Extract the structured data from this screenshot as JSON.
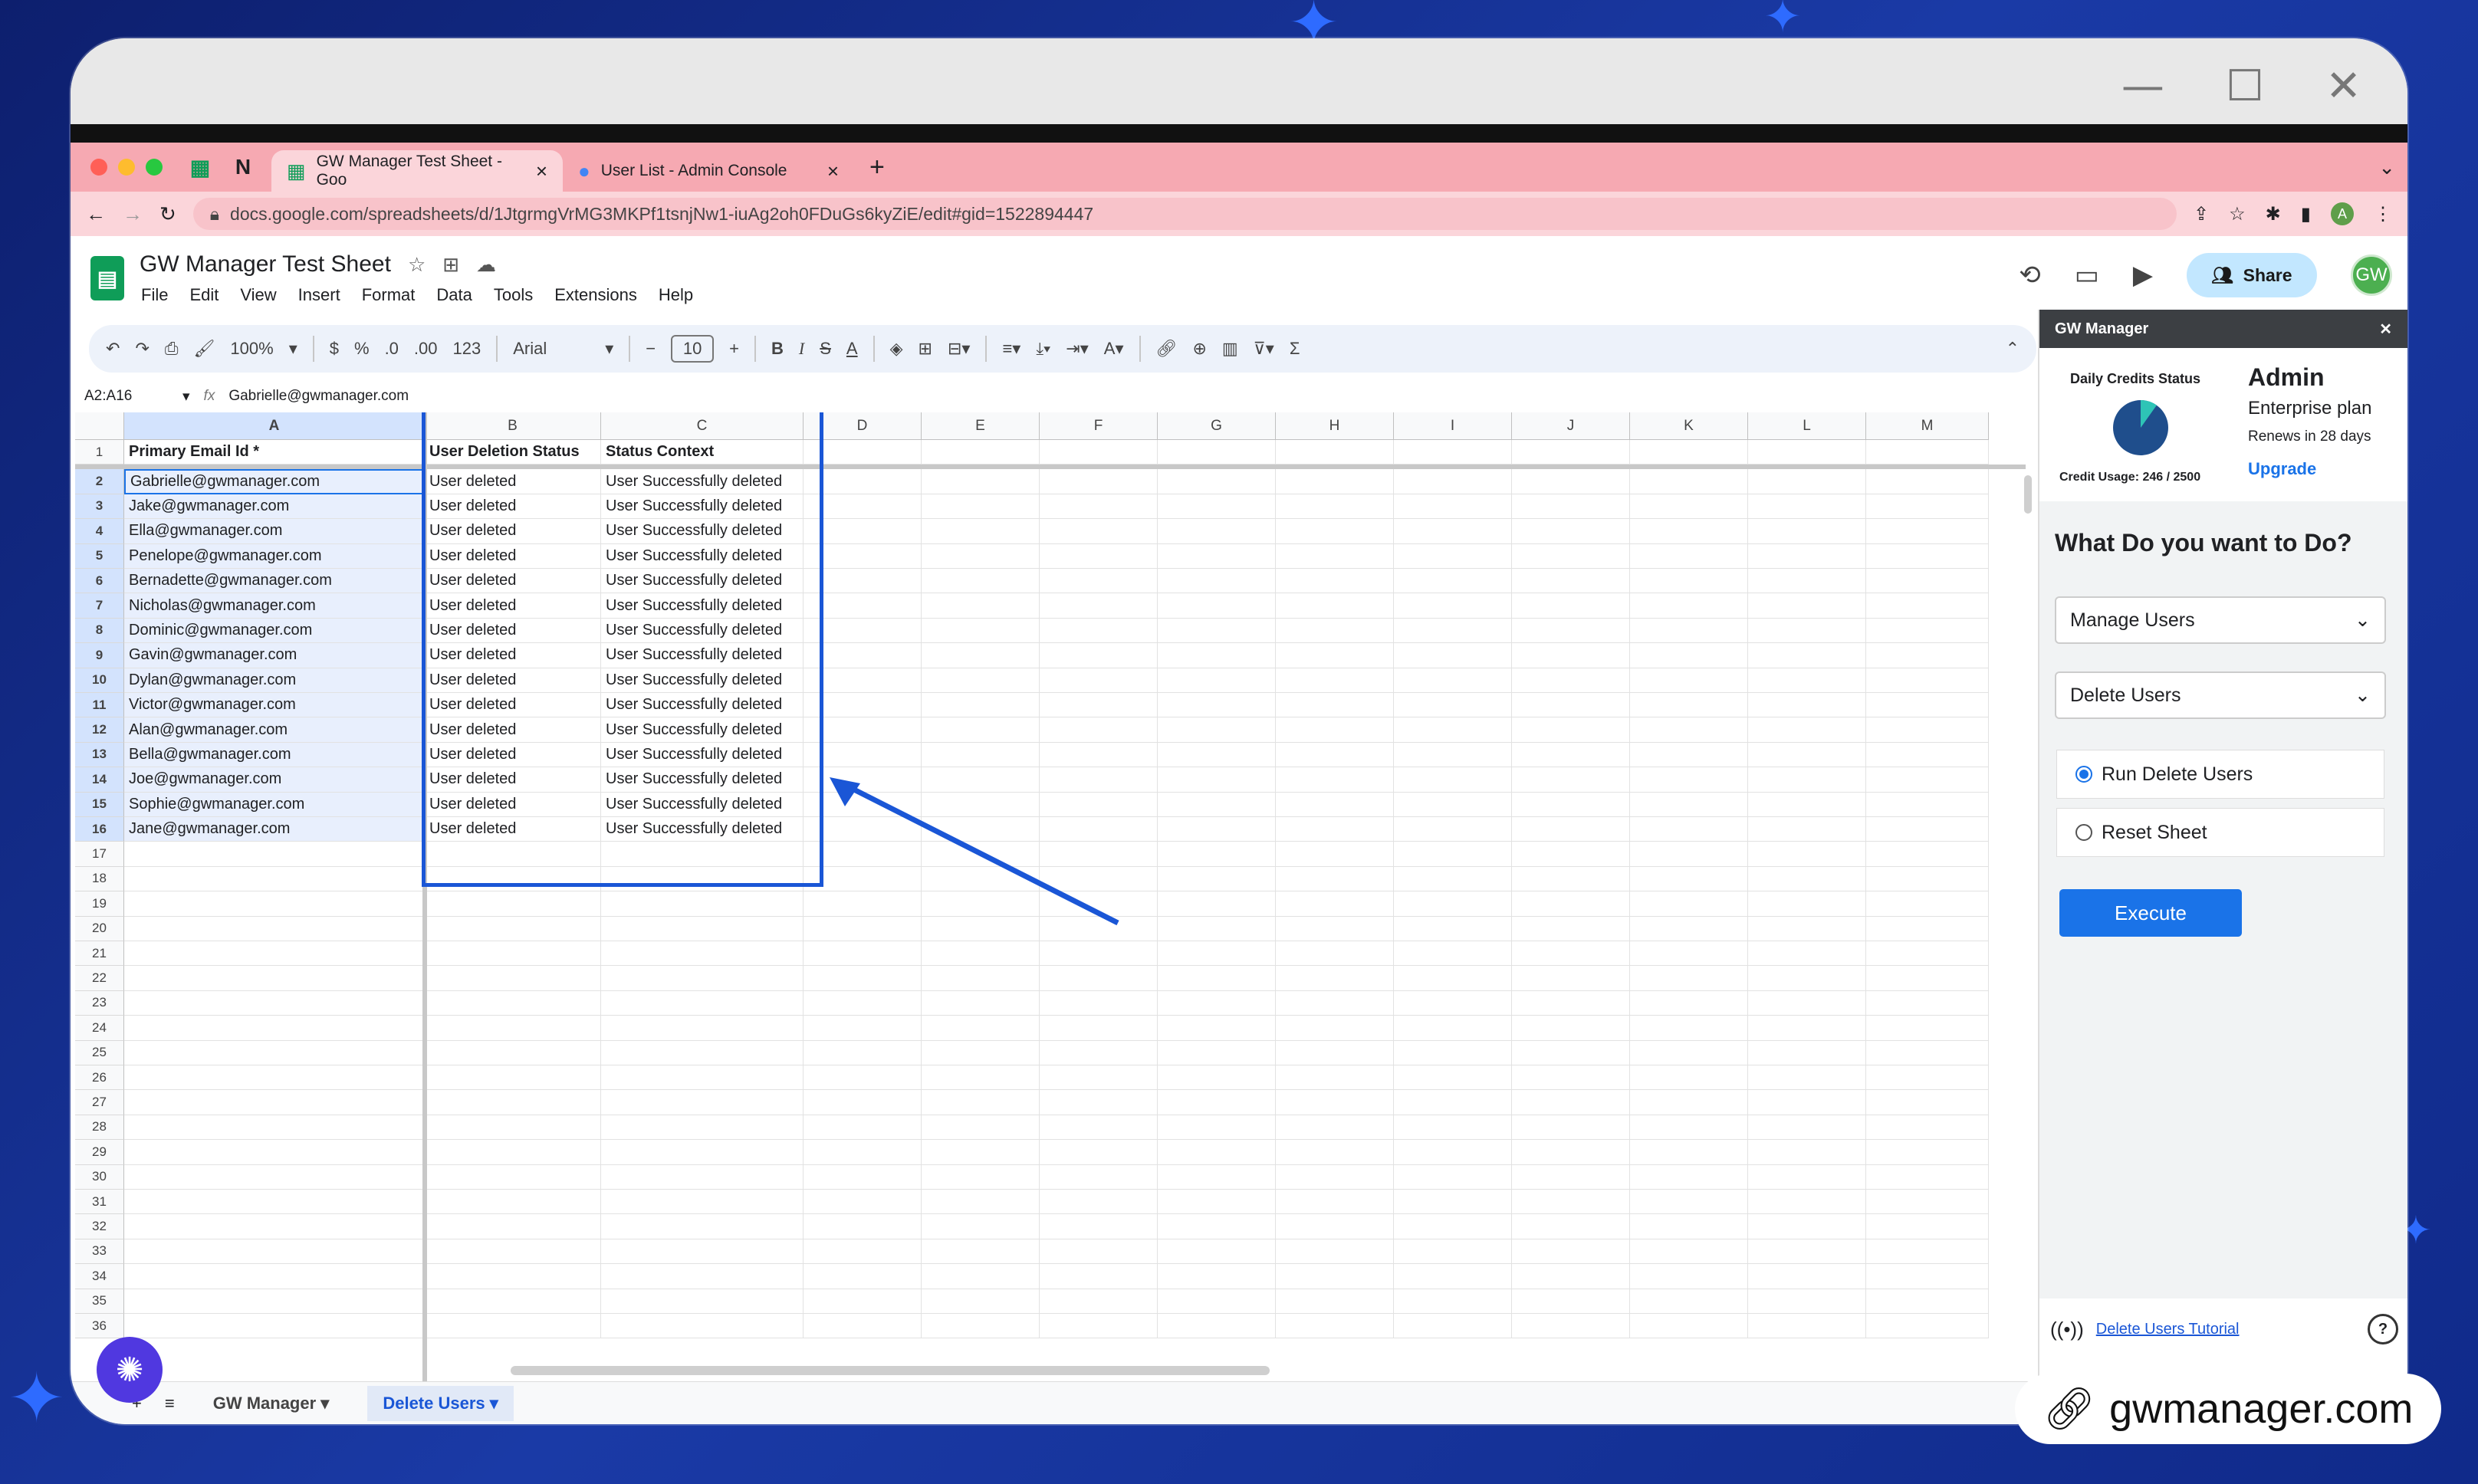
{
  "window": {
    "minimize": "—",
    "maximize": "☐",
    "close": "✕"
  },
  "browser": {
    "tabs": [
      {
        "label": "GW Manager Test Sheet - Goo",
        "active": true
      },
      {
        "label": "User List - Admin Console",
        "active": false
      }
    ],
    "url": "docs.google.com/spreadsheets/d/1JtgrmgVrMG3MKPf1tsnjNw1-iuAg2oh0FDuGs6kyZiE/edit#gid=1522894447",
    "avatar": "A"
  },
  "app": {
    "title": "GW Manager Test Sheet",
    "menu": [
      "File",
      "Edit",
      "View",
      "Insert",
      "Format",
      "Data",
      "Tools",
      "Extensions",
      "Help"
    ],
    "share_label": "Share",
    "user_avatar": "GW"
  },
  "toolbar": {
    "zoom": "100%",
    "currency": "$",
    "percent": "%",
    "dec_less": ".0",
    "dec_more": ".00",
    "number_format": "123",
    "font": "Arial",
    "font_size": "10"
  },
  "formula_bar": {
    "range": "A2:A16",
    "fx": "fx",
    "value": "Gabrielle@gwmanager.com"
  },
  "sheet": {
    "columns": [
      "A",
      "B",
      "C",
      "D",
      "E",
      "F",
      "G",
      "H",
      "I",
      "J",
      "K",
      "L",
      "M"
    ],
    "headers": [
      "Primary Email Id *",
      "User Deletion Status",
      "Status Context"
    ],
    "rows": [
      [
        "Gabrielle@gwmanager.com",
        "User deleted",
        "User Successfully deleted"
      ],
      [
        "Jake@gwmanager.com",
        "User deleted",
        "User Successfully deleted"
      ],
      [
        "Ella@gwmanager.com",
        "User deleted",
        "User Successfully deleted"
      ],
      [
        "Penelope@gwmanager.com",
        "User deleted",
        "User Successfully deleted"
      ],
      [
        "Bernadette@gwmanager.com",
        "User deleted",
        "User Successfully deleted"
      ],
      [
        "Nicholas@gwmanager.com",
        "User deleted",
        "User Successfully deleted"
      ],
      [
        "Dominic@gwmanager.com",
        "User deleted",
        "User Successfully deleted"
      ],
      [
        "Gavin@gwmanager.com",
        "User deleted",
        "User Successfully deleted"
      ],
      [
        "Dylan@gwmanager.com",
        "User deleted",
        "User Successfully deleted"
      ],
      [
        "Victor@gwmanager.com",
        "User deleted",
        "User Successfully deleted"
      ],
      [
        "Alan@gwmanager.com",
        "User deleted",
        "User Successfully deleted"
      ],
      [
        "Bella@gwmanager.com",
        "User deleted",
        "User Successfully deleted"
      ],
      [
        "Joe@gwmanager.com",
        "User deleted",
        "User Successfully deleted"
      ],
      [
        "Sophie@gwmanager.com",
        "User deleted",
        "User Successfully deleted"
      ],
      [
        "Jane@gwmanager.com",
        "User deleted",
        "User Successfully deleted"
      ]
    ],
    "row_count": 36,
    "tabs": [
      {
        "label": "GW Manager",
        "active": false
      },
      {
        "label": "Delete Users",
        "active": true
      }
    ],
    "highlight_color": "#1a56d6"
  },
  "panel": {
    "title": "GW Manager",
    "credits_label": "Daily Credits Status",
    "credit_usage": "Credit Usage: 246 / 2500",
    "credits_used": 246,
    "credits_total": 2500,
    "role": "Admin",
    "plan": "Enterprise plan",
    "renews": "Renews in 28 days",
    "upgrade": "Upgrade",
    "question": "What Do you want to Do?",
    "category": "Manage Users",
    "action": "Delete Users",
    "options": [
      {
        "label": "Run Delete Users",
        "selected": true
      },
      {
        "label": "Reset Sheet",
        "selected": false
      }
    ],
    "execute": "Execute",
    "tutorial": "Delete Users Tutorial"
  },
  "brand": "gwmanager.com"
}
